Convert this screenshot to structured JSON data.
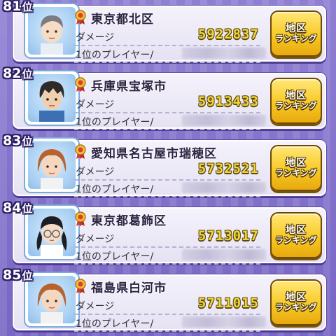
{
  "labels": {
    "damage": "ダメージ",
    "top_player": "1位のプレイヤー/",
    "button_line1": "地区",
    "button_line2": "ランキング"
  },
  "colors": {
    "background": "#8070c8",
    "card": "#eeebf7",
    "score": "#f0d53a",
    "button": "#f8c925",
    "outline": "#2b1f62"
  },
  "rows": [
    {
      "rank": "81",
      "rank_suffix": "位",
      "region": "東京都北区",
      "damage": "5922837",
      "avatar_icon": "character-avatar-gray-hair"
    },
    {
      "rank": "82",
      "rank_suffix": "位",
      "region": "兵庫県宝塚市",
      "damage": "5913433",
      "avatar_icon": "character-avatar-dark-hair"
    },
    {
      "rank": "83",
      "rank_suffix": "位",
      "region": "愛知県名古屋市瑞穂区",
      "damage": "5732521",
      "avatar_icon": "character-avatar-brown-hair"
    },
    {
      "rank": "84",
      "rank_suffix": "位",
      "region": "東京都葛飾区",
      "damage": "5713017",
      "avatar_icon": "character-avatar-glasses-pigtails"
    },
    {
      "rank": "85",
      "rank_suffix": "位",
      "region": "福島県白河市",
      "damage": "5711015",
      "avatar_icon": "character-avatar-brown-hair"
    }
  ]
}
